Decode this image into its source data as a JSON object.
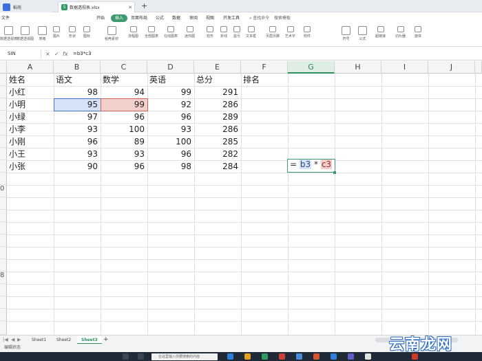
{
  "tabs": {
    "home_label": "稻壳",
    "doc_label": "数据透视表.xlsx",
    "doc_icon_letter": "S",
    "new_tab": "+"
  },
  "menu": {
    "file": "文件",
    "items": [
      "开始",
      "插入",
      "页面布局",
      "公式",
      "数据",
      "审阅",
      "视图",
      "开发工具"
    ],
    "active": "插入",
    "search_placeholder": "查找命令",
    "template_search": "搜索模板"
  },
  "ribbon": {
    "items": [
      "数据透视表",
      "数据透视图",
      "表格",
      "图片",
      "形状",
      "图标",
      "稻壳素材",
      "流程图",
      "全部图表",
      "在线图表",
      "迷你图",
      "柱形",
      "折线",
      "盈亏",
      "文本框",
      "页眉页脚",
      "艺术字",
      "附件",
      "符号",
      "公式",
      "超链接",
      "切片器",
      "窗体"
    ]
  },
  "formula_bar": {
    "name_box": "SIN",
    "cancel": "×",
    "confirm": "✓",
    "fx": "fx",
    "formula": "=b3*c3"
  },
  "columns": [
    "A",
    "B",
    "C",
    "D",
    "E",
    "F",
    "G",
    "H",
    "I",
    "J"
  ],
  "selected_column": "G",
  "rows": {
    "visible_numbers": [
      "",
      "",
      "",
      "",
      "",
      "",
      "",
      "",
      "",
      "0",
      "",
      "",
      "",
      "",
      "",
      "8",
      "",
      "",
      "",
      "",
      ""
    ]
  },
  "table": {
    "headers": [
      "姓名",
      "语文",
      "数学",
      "英语",
      "总分",
      "排名"
    ],
    "data": [
      [
        "小红",
        "98",
        "94",
        "99",
        "291"
      ],
      [
        "小明",
        "95",
        "99",
        "92",
        "286"
      ],
      [
        "小绿",
        "97",
        "96",
        "96",
        "289"
      ],
      [
        "小李",
        "93",
        "100",
        "93",
        "286"
      ],
      [
        "小刚",
        "96",
        "89",
        "100",
        "285"
      ],
      [
        "小王",
        "93",
        "93",
        "96",
        "282"
      ],
      [
        "小张",
        "90",
        "96",
        "98",
        "284"
      ]
    ]
  },
  "editing_cell": {
    "eq": "=",
    "ref1": "b3",
    "op": "*",
    "ref2": "c3"
  },
  "sheets": {
    "tabs": [
      "Sheet1",
      "Sheet2",
      "Sheet3"
    ],
    "active": "Sheet3",
    "add": "+"
  },
  "status": {
    "text": "编辑状态"
  },
  "taskbar": {
    "search_placeholder": "在这里输入你要搜索的内容"
  },
  "watermark": "云南龙网",
  "colors": {
    "accent_green": "#3f9b6f",
    "ref_blue": "#d6e2f6",
    "ref_red": "#f3cfcc"
  }
}
